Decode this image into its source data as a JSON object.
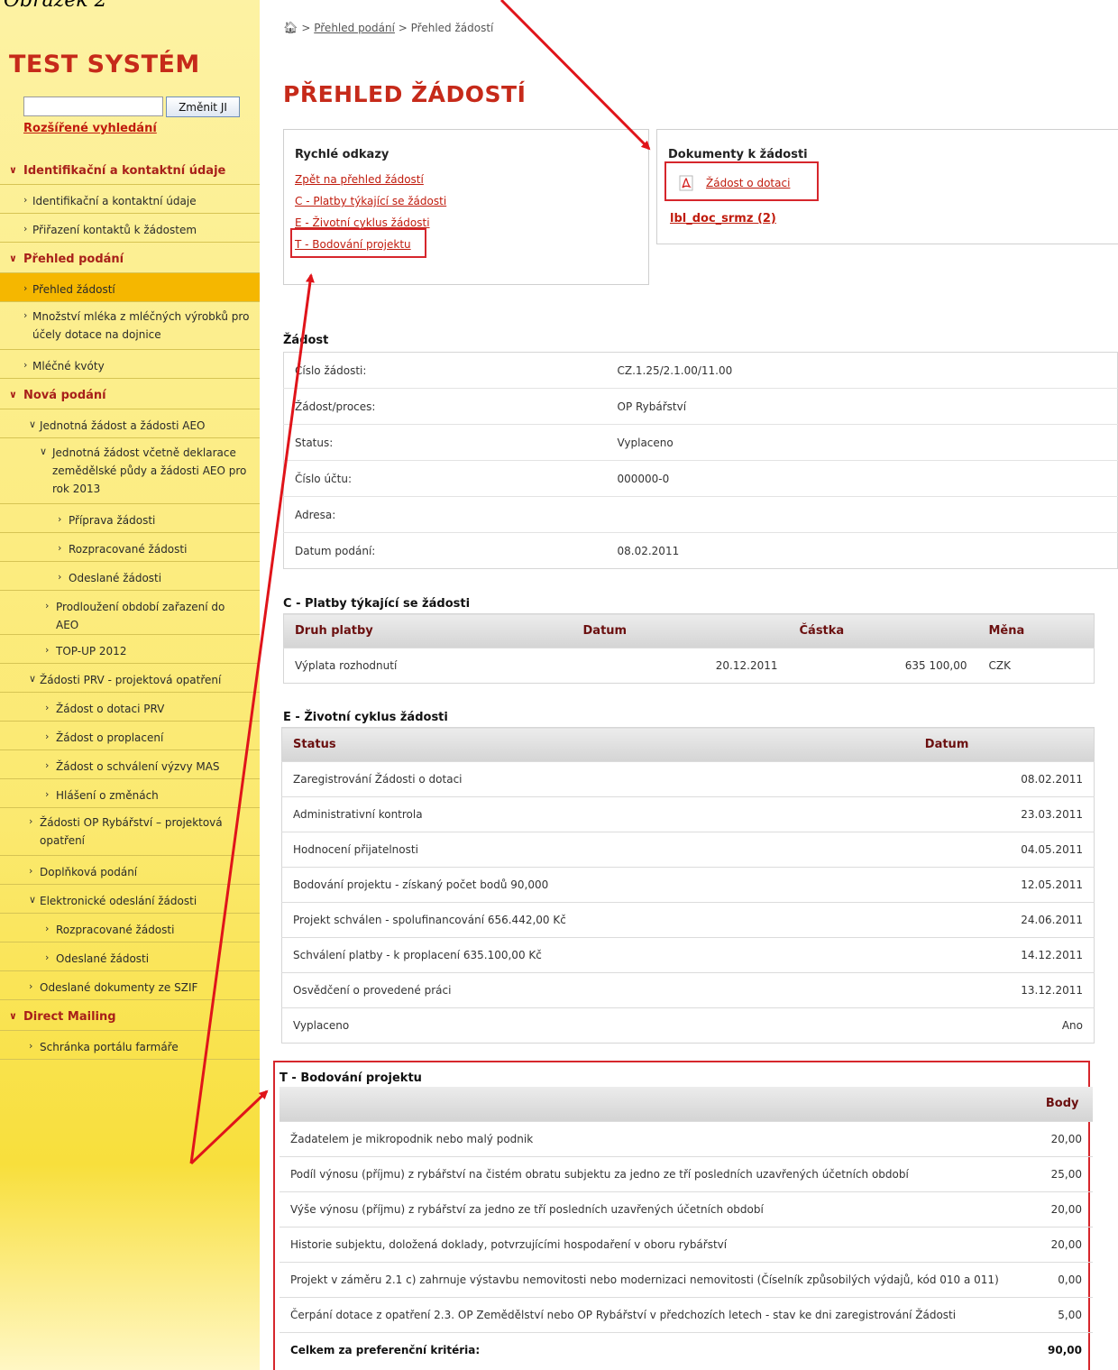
{
  "caption": "Obrázek 2",
  "sidebar": {
    "system_title": "TEST SYSTÉM",
    "search": {
      "value": "",
      "button_label": "Změnit JI"
    },
    "advanced_search": "Rozšířené vyhledání",
    "nav": [
      {
        "label": "Identifikační a kontaktní údaje",
        "type": "section"
      },
      {
        "label": "Identifikační a kontaktní údaje",
        "type": "item"
      },
      {
        "label": "Přiřazení kontaktů k žádostem",
        "type": "item"
      },
      {
        "label": "Přehled podání",
        "type": "section"
      },
      {
        "label": "Přehled žádostí",
        "type": "item-active"
      },
      {
        "label": "Množství mléka z mléčných výrobků pro účely dotace na dojnice",
        "type": "item"
      },
      {
        "label": "Mléčné kvóty",
        "type": "item"
      },
      {
        "label": "Nová podání",
        "type": "section"
      },
      {
        "label": "Jednotná žádost a žádosti AEO",
        "type": "sub-open"
      },
      {
        "label": "Jednotná žádost včetně deklarace zemědělské půdy a žádosti AEO pro rok 2013",
        "type": "sub2-open"
      },
      {
        "label": "Příprava žádosti",
        "type": "sub3"
      },
      {
        "label": "Rozpracované žádosti",
        "type": "sub3"
      },
      {
        "label": "Odeslané žádosti",
        "type": "sub3"
      },
      {
        "label": "Prodloužení období zařazení do AEO",
        "type": "sub2"
      },
      {
        "label": "TOP-UP 2012",
        "type": "sub2"
      },
      {
        "label": "Žádosti PRV - projektová opatření",
        "type": "sub-open"
      },
      {
        "label": "Žádost o dotaci PRV",
        "type": "sub2"
      },
      {
        "label": "Žádost o proplacení",
        "type": "sub2"
      },
      {
        "label": "Žádost o schválení výzvy MAS",
        "type": "sub2"
      },
      {
        "label": "Hlášení o změnách",
        "type": "sub2"
      },
      {
        "label": "Žádosti OP Rybářství – projektová opatření",
        "type": "sub"
      },
      {
        "label": "Doplňková podání",
        "type": "sub"
      },
      {
        "label": "Elektronické odeslání žádosti",
        "type": "sub-open"
      },
      {
        "label": "Rozpracované žádosti",
        "type": "sub2"
      },
      {
        "label": "Odeslané žádosti",
        "type": "sub2"
      },
      {
        "label": "Odeslané dokumenty ze SZIF",
        "type": "sub"
      },
      {
        "label": "Direct Mailing",
        "type": "section"
      },
      {
        "label": "Schránka portálu farmáře",
        "type": "sub"
      }
    ]
  },
  "breadcrumb": {
    "sep": ">",
    "level1": "Přehled podání",
    "level2": "Přehled žádostí"
  },
  "page_title": "PŘEHLED ŽÁDOSTÍ",
  "quick_links": {
    "title": "Rychlé odkazy",
    "links": [
      "Zpět na přehled žádostí",
      "C - Platby týkající se žádosti",
      "E - Životní cyklus žádosti",
      "T - Bodování projektu"
    ]
  },
  "documents": {
    "title": "Dokumenty k žádosti",
    "pdf_link": "Žádost o dotaci",
    "other_link": "lbl_doc_srmz (2)"
  },
  "detail": {
    "title": "Žádost",
    "rows": [
      {
        "label": "Číslo žádosti:",
        "value": "CZ.1.25/2.1.00/11.00"
      },
      {
        "label": "Žádost/proces:",
        "value": "OP Rybářství"
      },
      {
        "label": "Status:",
        "value": "Vyplaceno"
      },
      {
        "label": "Číslo účtu:",
        "value": "000000-0"
      },
      {
        "label": "Adresa:",
        "value": ""
      },
      {
        "label": "Datum podání:",
        "value": "08.02.2011"
      }
    ]
  },
  "payments": {
    "title": "C - Platby týkající se žádosti",
    "headers": [
      "Druh platby",
      "Datum",
      "Částka",
      "Měna"
    ],
    "rows": [
      {
        "type": "Výplata rozhodnutí",
        "date": "20.12.2011",
        "amount": "635 100,00",
        "currency": "CZK"
      }
    ]
  },
  "lifecycle": {
    "title": "E - Životní cyklus žádosti",
    "headers": [
      "Status",
      "Datum"
    ],
    "rows": [
      {
        "status": "Zaregistrování Žádosti o dotaci",
        "date": "08.02.2011"
      },
      {
        "status": "Administrativní kontrola",
        "date": "23.03.2011"
      },
      {
        "status": "Hodnocení přijatelnosti",
        "date": "04.05.2011"
      },
      {
        "status": "Bodování projektu - získaný počet bodů 90,000",
        "date": "12.05.2011"
      },
      {
        "status": "Projekt schválen - spolufinancování 656.442,00 Kč",
        "date": "24.06.2011"
      },
      {
        "status": "Schválení platby - k proplacení 635.100,00 Kč",
        "date": "14.12.2011"
      },
      {
        "status": "Osvědčení o provedené práci",
        "date": "13.12.2011"
      },
      {
        "status": "Vyplaceno",
        "date": "Ano"
      }
    ]
  },
  "scoring": {
    "title": "T - Bodování projektu",
    "headers": [
      "",
      "Body"
    ],
    "rows": [
      {
        "criterion": "Žadatelem je mikropodnik nebo malý podnik",
        "points": "20,00"
      },
      {
        "criterion": "Podíl výnosu (příjmu) z rybářství na čistém obratu subjektu za jedno ze tří posledních uzavřených účetních období",
        "points": "25,00"
      },
      {
        "criterion": "Výše výnosu (příjmu) z rybářství za jedno ze tří posledních uzavřených účetních období",
        "points": "20,00"
      },
      {
        "criterion": "Historie subjektu, doložená doklady, potvrzujícími hospodaření v oboru rybářství",
        "points": "20,00"
      },
      {
        "criterion": "Projekt v záměru 2.1 c) zahrnuje výstavbu nemovitosti nebo modernizaci nemovitosti (Číselník způsobilých výdajů, kód 010 a 011)",
        "points": "0,00"
      },
      {
        "criterion": "Čerpání dotace z opatření 2.3. OP Zemědělství nebo OP Rybářství v předchozích letech - stav ke dni zaregistrování Žádosti",
        "points": "5,00"
      }
    ],
    "total_label": "Celkem za preferenční kritéria:",
    "total_points": "90,00"
  },
  "colors": {
    "accent": "#c62a1a",
    "annotation": "#e0141a",
    "active_nav": "#f5b700"
  }
}
